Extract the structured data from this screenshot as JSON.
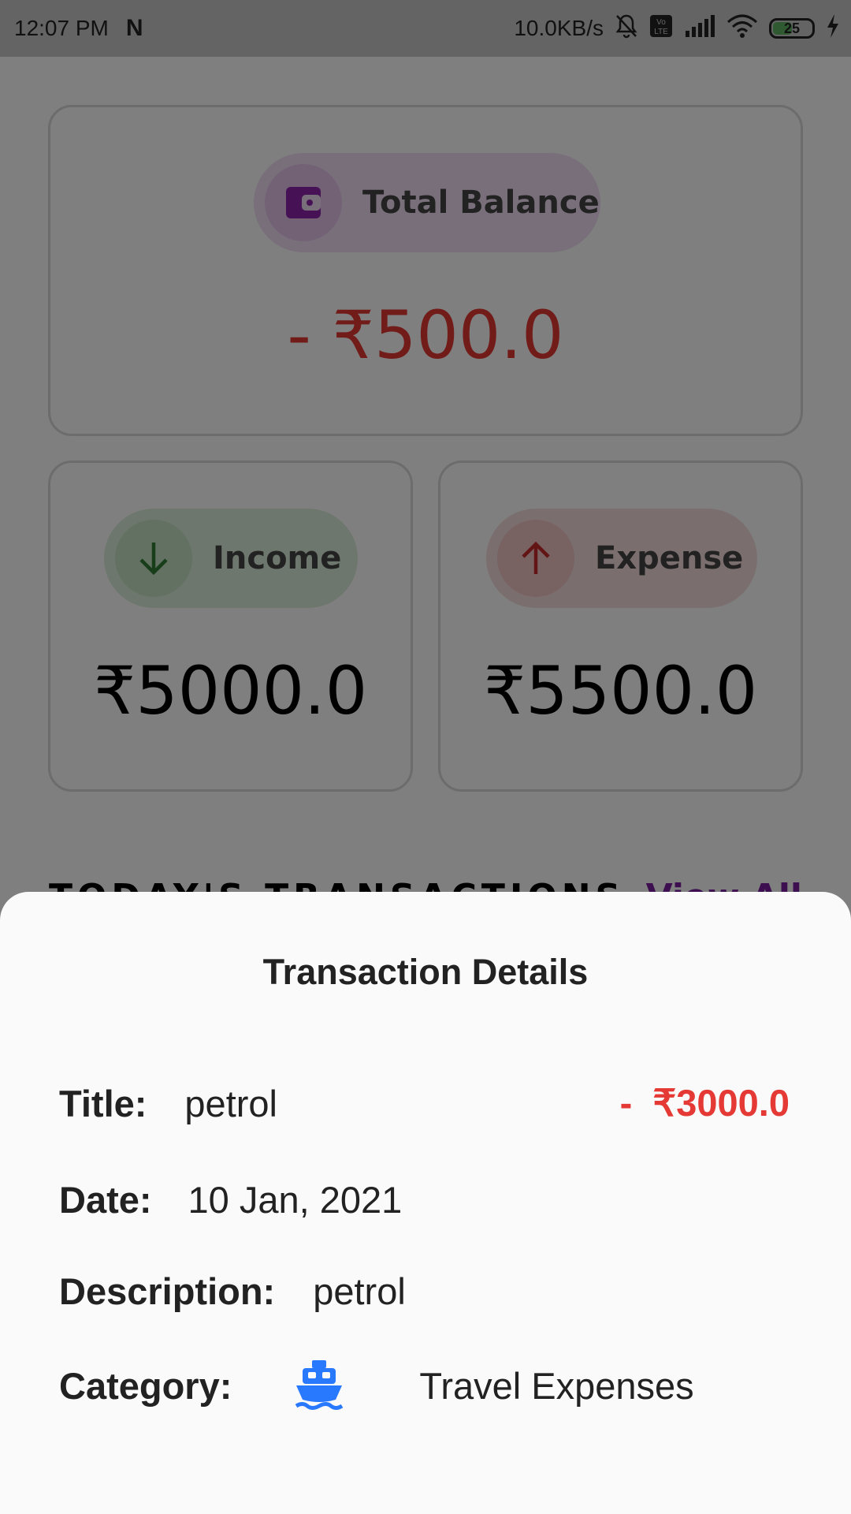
{
  "status_bar": {
    "time": "12:07 PM",
    "carrier_glyph": "N",
    "net_speed": "10.0KB/s",
    "battery_level": "25",
    "volte_label": "Vo LTE"
  },
  "dashboard": {
    "total_balance": {
      "label": "Total Balance",
      "amount": "- ₹500.0",
      "icon": "wallet-icon"
    },
    "income": {
      "label": "Income",
      "amount": "₹5000.0",
      "icon": "arrow-down-icon"
    },
    "expense": {
      "label": "Expense",
      "amount": "₹5500.0",
      "icon": "arrow-up-icon"
    },
    "section_title": "TODAY'S TRANSACTIONS",
    "view_all": "View All"
  },
  "sheet": {
    "title": "Transaction Details",
    "title_label": "Title:",
    "title_value": "petrol",
    "amount": "-  ₹3000.0",
    "date_label": "Date:",
    "date_value": "10 Jan, 2021",
    "description_label": "Description:",
    "description_value": "petrol",
    "category_label": "Category:",
    "category_icon": "ship-icon",
    "category_value": "Travel Expenses"
  },
  "colors": {
    "negative": "#e53935",
    "income_green": "#2e7d32",
    "expense_red": "#c62828",
    "wallet_purple": "#8e24aa",
    "category_blue": "#2979ff",
    "battery_green": "#4caf50"
  }
}
